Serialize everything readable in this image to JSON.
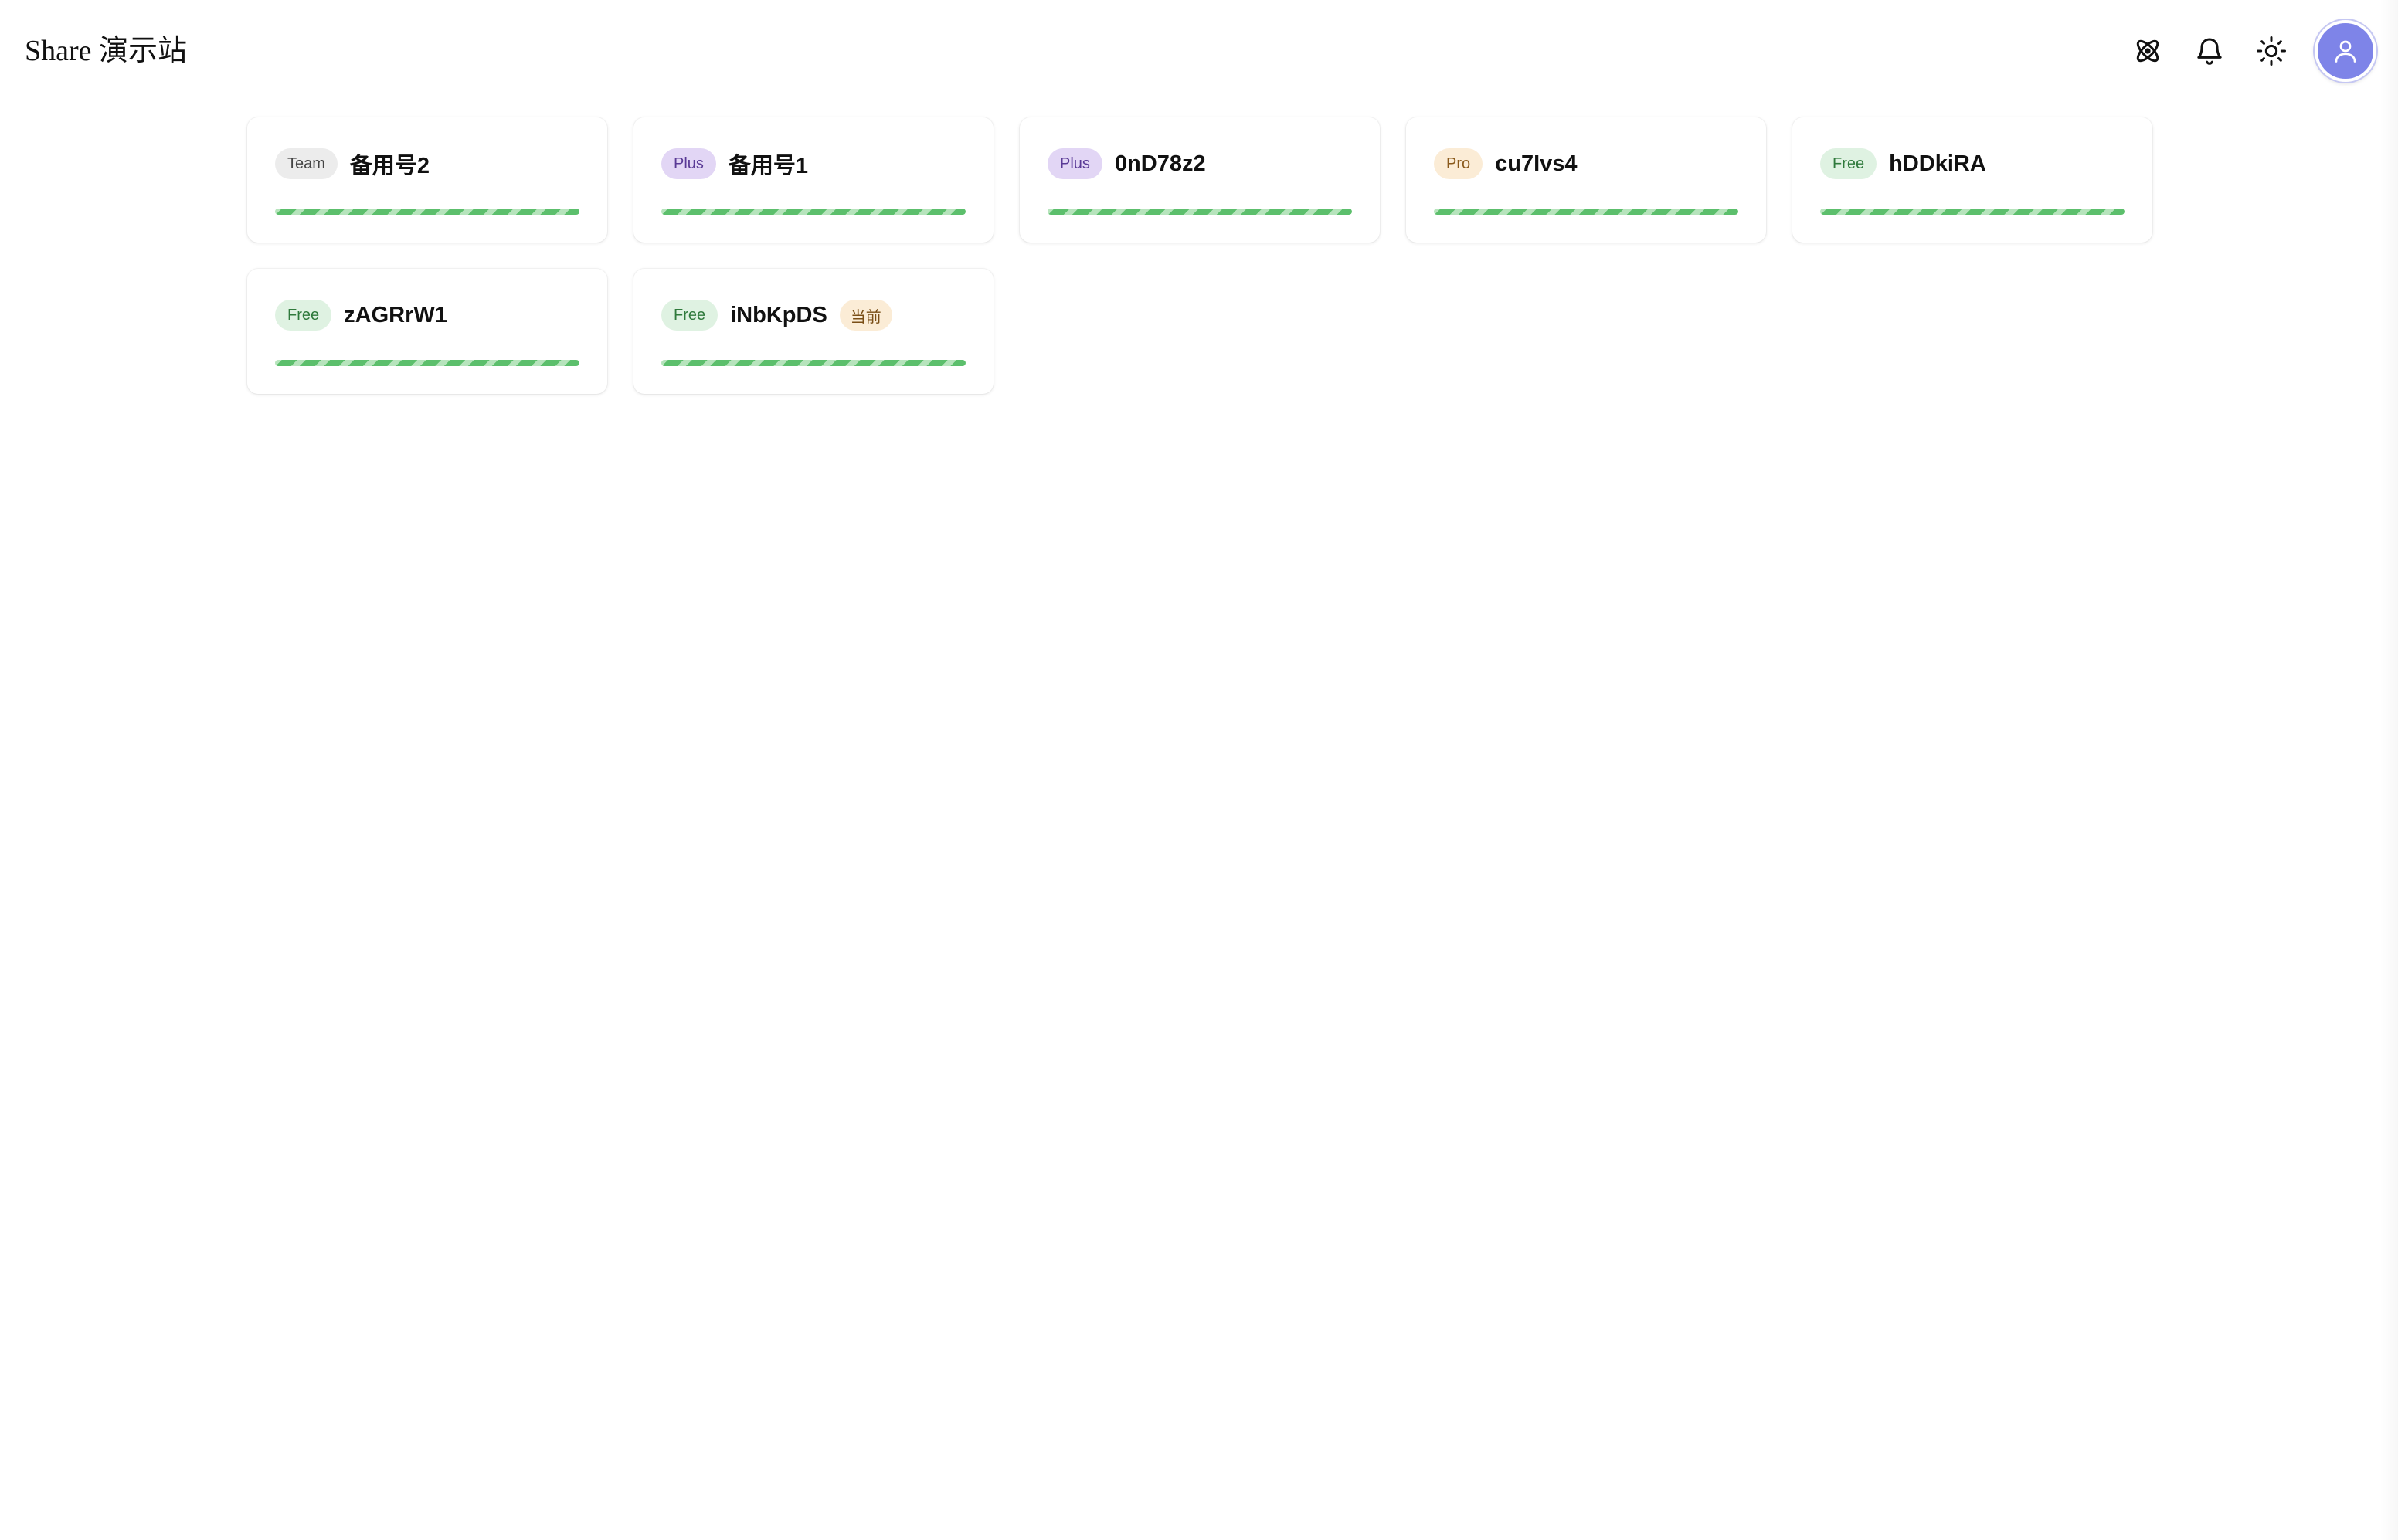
{
  "header": {
    "title": "Share 演示站",
    "icons": [
      "atom-icon",
      "bell-icon",
      "sun-icon",
      "user-icon"
    ]
  },
  "colors": {
    "accent": "#7e84e8",
    "progress": "#5cbf6c",
    "badge_free": "#dff2e2",
    "badge_plus": "#e2d6f5",
    "badge_pro": "#fbecd6",
    "badge_team": "#ececec"
  },
  "accounts": [
    {
      "plan": "Team",
      "plan_class": "team",
      "name": "备用号2",
      "current": "",
      "progress": 1.0
    },
    {
      "plan": "Plus",
      "plan_class": "plus",
      "name": "备用号1",
      "current": "",
      "progress": 1.0
    },
    {
      "plan": "Plus",
      "plan_class": "plus",
      "name": "0nD78z2",
      "current": "",
      "progress": 1.0
    },
    {
      "plan": "Pro",
      "plan_class": "pro",
      "name": "cu7Ivs4",
      "current": "",
      "progress": 1.0
    },
    {
      "plan": "Free",
      "plan_class": "free",
      "name": "hDDkiRA",
      "current": "",
      "progress": 1.0
    },
    {
      "plan": "Free",
      "plan_class": "free",
      "name": "zAGRrW1",
      "current": "",
      "progress": 1.0
    },
    {
      "plan": "Free",
      "plan_class": "free",
      "name": "iNbKpDS",
      "current": "当前",
      "progress": 1.0
    }
  ]
}
